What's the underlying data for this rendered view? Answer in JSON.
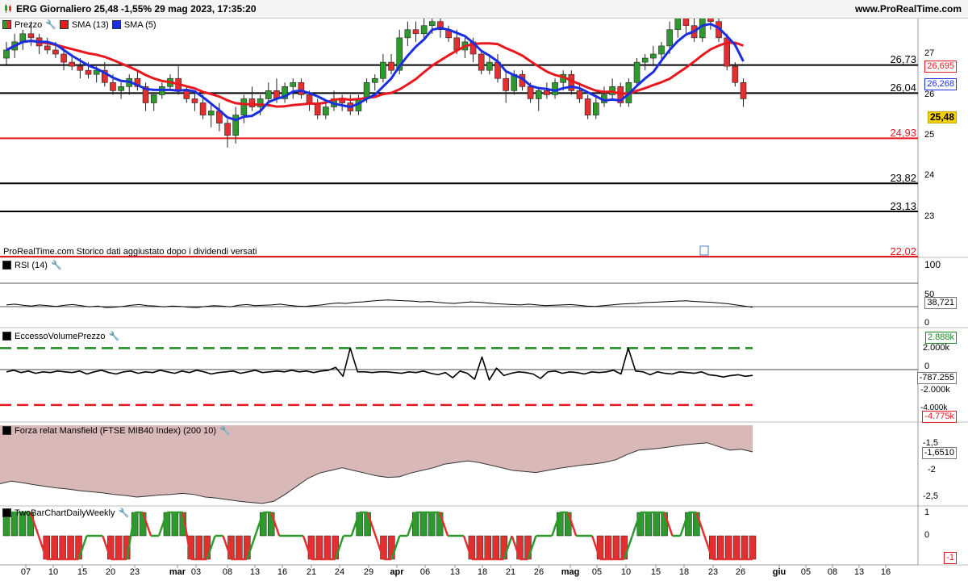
{
  "header": {
    "title": "ERG Giornaliero 25,48 -1,55% 29 mag 2023, 17:35:20",
    "site": "www.ProRealTime.com"
  },
  "price_panel": {
    "legend": [
      "Prezzo",
      "SMA (13)",
      "SMA (5)"
    ],
    "note": "ProRealTime.com  Storico dati aggiustato dopo i dividendi versati",
    "levels": [
      "26,73",
      "26,04",
      "24,93",
      "23,82",
      "23,13",
      "22,02"
    ],
    "axis_ticks": [
      "27",
      "26",
      "25",
      "24",
      "23"
    ],
    "tags": {
      "sma13": "26,695",
      "sma5": "26,268",
      "price": "25,48"
    }
  },
  "rsi_panel": {
    "legend": "RSI (14)",
    "axis_ticks": [
      "100",
      "50",
      "0"
    ],
    "tag": "38,721"
  },
  "evp_panel": {
    "legend": "EccessoVolumePrezzo",
    "axis_ticks": [
      "2.000k",
      "0",
      "-2.000k",
      "-4.000k"
    ],
    "tags": {
      "upper": "2.888k",
      "value": "-787.255",
      "lower": "-4.775k"
    }
  },
  "mansfield_panel": {
    "legend": "Forza relat Mansfield (FTSE MIB40 Index) (200 10)",
    "axis_ticks": [
      "-1,5",
      "-2",
      "-2,5"
    ],
    "tag": "-1,6510"
  },
  "twobar_panel": {
    "legend": "TwoBarChartDailyWeekly",
    "axis_ticks": [
      "1",
      "0"
    ],
    "tag": "-1"
  },
  "x_axis": [
    {
      "label": "07",
      "bold": false
    },
    {
      "label": "10",
      "bold": false
    },
    {
      "label": "15",
      "bold": false
    },
    {
      "label": "20",
      "bold": false
    },
    {
      "label": "23",
      "bold": false
    },
    {
      "label": "mar",
      "bold": true
    },
    {
      "label": "03",
      "bold": false
    },
    {
      "label": "08",
      "bold": false
    },
    {
      "label": "13",
      "bold": false
    },
    {
      "label": "16",
      "bold": false
    },
    {
      "label": "21",
      "bold": false
    },
    {
      "label": "24",
      "bold": false
    },
    {
      "label": "29",
      "bold": false
    },
    {
      "label": "apr",
      "bold": true
    },
    {
      "label": "06",
      "bold": false
    },
    {
      "label": "13",
      "bold": false
    },
    {
      "label": "18",
      "bold": false
    },
    {
      "label": "21",
      "bold": false
    },
    {
      "label": "26",
      "bold": false
    },
    {
      "label": "mag",
      "bold": true
    },
    {
      "label": "05",
      "bold": false
    },
    {
      "label": "10",
      "bold": false
    },
    {
      "label": "15",
      "bold": false
    },
    {
      "label": "18",
      "bold": false
    },
    {
      "label": "23",
      "bold": false
    },
    {
      "label": "26",
      "bold": false
    },
    {
      "label": "giu",
      "bold": true
    },
    {
      "label": "05",
      "bold": false
    },
    {
      "label": "08",
      "bold": false
    },
    {
      "label": "13",
      "bold": false
    },
    {
      "label": "16",
      "bold": false
    }
  ],
  "colors": {
    "up": "#2e9a2e",
    "down": "#e23030",
    "sma13": "#e8181f",
    "sma5": "#1a2fe0",
    "area": "#d9b8b8"
  },
  "chart_data": [
    {
      "type": "candlestick",
      "title": "ERG Giornaliero",
      "ylim": [
        22.0,
        27.5
      ],
      "horizontal_levels": [
        26.73,
        26.04,
        24.93,
        23.82,
        23.13,
        22.02
      ],
      "ohlc": [
        [
          26.9,
          27.3,
          26.7,
          27.1
        ],
        [
          27.1,
          27.5,
          26.9,
          27.3
        ],
        [
          27.3,
          27.6,
          27.1,
          27.5
        ],
        [
          27.5,
          27.8,
          27.2,
          27.4
        ],
        [
          27.4,
          27.5,
          27.0,
          27.2
        ],
        [
          27.2,
          27.4,
          27.0,
          27.1
        ],
        [
          27.1,
          27.3,
          26.9,
          27.0
        ],
        [
          27.0,
          27.2,
          26.6,
          26.8
        ],
        [
          26.8,
          27.0,
          26.6,
          26.7
        ],
        [
          26.7,
          26.9,
          26.4,
          26.6
        ],
        [
          26.6,
          26.8,
          26.4,
          26.5
        ],
        [
          26.5,
          26.7,
          26.3,
          26.6
        ],
        [
          26.6,
          26.8,
          26.2,
          26.3
        ],
        [
          26.3,
          26.5,
          26.0,
          26.1
        ],
        [
          26.1,
          26.3,
          25.9,
          26.2
        ],
        [
          26.2,
          26.5,
          26.0,
          26.4
        ],
        [
          26.4,
          26.6,
          26.1,
          26.2
        ],
        [
          26.2,
          26.3,
          25.6,
          25.8
        ],
        [
          25.8,
          26.0,
          25.6,
          26.0
        ],
        [
          26.0,
          26.3,
          25.9,
          26.2
        ],
        [
          26.2,
          26.5,
          26.1,
          26.4
        ],
        [
          26.4,
          26.7,
          26.0,
          26.1
        ],
        [
          26.1,
          26.2,
          25.8,
          25.9
        ],
        [
          25.9,
          26.1,
          25.6,
          25.8
        ],
        [
          25.8,
          26.0,
          25.4,
          25.5
        ],
        [
          25.5,
          25.8,
          25.2,
          25.6
        ],
        [
          25.6,
          25.8,
          25.1,
          25.3
        ],
        [
          25.3,
          25.4,
          24.7,
          25.0
        ],
        [
          25.0,
          25.7,
          24.8,
          25.5
        ],
        [
          25.5,
          26.0,
          25.3,
          25.9
        ],
        [
          25.9,
          26.2,
          25.6,
          25.7
        ],
        [
          25.7,
          26.0,
          25.5,
          25.9
        ],
        [
          25.9,
          26.3,
          25.7,
          26.1
        ],
        [
          26.1,
          26.4,
          25.8,
          25.9
        ],
        [
          25.9,
          26.3,
          25.8,
          26.2
        ],
        [
          26.2,
          26.4,
          25.9,
          26.3
        ],
        [
          26.3,
          26.4,
          25.9,
          26.0
        ],
        [
          26.0,
          26.1,
          25.6,
          25.8
        ],
        [
          25.8,
          25.9,
          25.4,
          25.5
        ],
        [
          25.5,
          25.8,
          25.4,
          25.7
        ],
        [
          25.7,
          26.1,
          25.6,
          25.9
        ],
        [
          25.9,
          26.0,
          25.6,
          25.8
        ],
        [
          25.8,
          26.0,
          25.5,
          25.6
        ],
        [
          25.6,
          26.0,
          25.5,
          25.9
        ],
        [
          25.9,
          26.4,
          25.8,
          26.3
        ],
        [
          26.3,
          26.5,
          26.1,
          26.4
        ],
        [
          26.4,
          27.0,
          26.3,
          26.8
        ],
        [
          26.8,
          27.0,
          26.5,
          26.6
        ],
        [
          26.6,
          27.6,
          26.5,
          27.4
        ],
        [
          27.4,
          27.8,
          27.2,
          27.6
        ],
        [
          27.6,
          27.8,
          27.3,
          27.5
        ],
        [
          27.5,
          27.9,
          27.4,
          27.7
        ],
        [
          27.7,
          27.9,
          27.5,
          27.8
        ],
        [
          27.8,
          27.9,
          27.4,
          27.6
        ],
        [
          27.6,
          27.7,
          27.3,
          27.4
        ],
        [
          27.4,
          27.6,
          27.0,
          27.1
        ],
        [
          27.1,
          27.4,
          26.9,
          27.3
        ],
        [
          27.3,
          27.4,
          26.8,
          27.0
        ],
        [
          27.0,
          27.1,
          26.5,
          26.6
        ],
        [
          26.6,
          27.0,
          26.5,
          26.8
        ],
        [
          26.8,
          27.0,
          26.3,
          26.4
        ],
        [
          26.4,
          26.6,
          25.8,
          26.1
        ],
        [
          26.1,
          26.6,
          26.0,
          26.5
        ],
        [
          26.5,
          26.6,
          26.1,
          26.2
        ],
        [
          26.2,
          26.3,
          25.8,
          25.9
        ],
        [
          25.9,
          26.2,
          25.6,
          26.1
        ],
        [
          26.1,
          26.3,
          25.9,
          26.0
        ],
        [
          26.0,
          26.4,
          25.9,
          26.3
        ],
        [
          26.3,
          26.6,
          26.1,
          26.5
        ],
        [
          26.5,
          26.6,
          26.0,
          26.1
        ],
        [
          26.1,
          26.3,
          25.8,
          25.9
        ],
        [
          25.9,
          26.0,
          25.4,
          25.5
        ],
        [
          25.5,
          26.0,
          25.4,
          25.8
        ],
        [
          25.8,
          26.2,
          25.7,
          26.0
        ],
        [
          26.0,
          26.4,
          25.9,
          26.2
        ],
        [
          26.2,
          26.3,
          25.7,
          25.8
        ],
        [
          25.8,
          26.4,
          25.7,
          26.3
        ],
        [
          26.3,
          26.9,
          26.2,
          26.8
        ],
        [
          26.8,
          27.0,
          26.6,
          26.9
        ],
        [
          26.9,
          27.2,
          26.7,
          27.0
        ],
        [
          27.0,
          27.3,
          26.8,
          27.2
        ],
        [
          27.2,
          27.8,
          27.0,
          27.6
        ],
        [
          27.6,
          28.1,
          27.4,
          27.9
        ],
        [
          27.9,
          28.0,
          27.5,
          27.7
        ],
        [
          27.7,
          27.9,
          27.3,
          27.4
        ],
        [
          27.4,
          28.2,
          27.3,
          27.9
        ],
        [
          27.9,
          28.0,
          27.6,
          27.8
        ],
        [
          27.8,
          27.9,
          27.3,
          27.4
        ],
        [
          27.4,
          27.5,
          26.6,
          26.7
        ],
        [
          26.7,
          26.8,
          26.2,
          26.3
        ],
        [
          26.3,
          26.4,
          25.7,
          25.9
        ]
      ]
    },
    {
      "type": "line",
      "name": "SMA (13)",
      "last": 26.695
    },
    {
      "type": "line",
      "name": "SMA (5)",
      "last": 26.268
    },
    {
      "type": "line",
      "name": "RSI (14)",
      "ylim": [
        0,
        100
      ],
      "values": [
        45,
        47,
        44,
        42,
        45,
        43,
        41,
        44,
        46,
        43,
        40,
        42,
        38,
        39,
        41,
        44,
        46,
        43,
        42,
        40,
        42,
        41,
        39,
        38,
        41,
        43,
        42,
        40,
        44,
        46,
        43,
        44,
        45,
        47,
        44,
        42,
        41,
        43,
        45,
        48,
        50,
        49,
        52,
        53,
        55,
        57,
        58,
        57,
        56,
        55,
        53,
        54,
        52,
        50,
        49,
        51,
        53,
        52,
        50,
        48,
        47,
        46,
        45,
        47,
        45,
        43,
        44,
        45,
        46,
        44,
        42,
        41,
        43,
        45,
        47,
        48,
        49,
        51,
        52,
        53,
        54,
        55,
        56,
        54,
        53,
        52,
        50,
        48,
        45,
        42,
        38.721
      ]
    },
    {
      "type": "line",
      "name": "EccessoVolumePrezzo",
      "ylim": [
        -5000,
        3200
      ],
      "upper_band": 2888,
      "lower_band": -4775,
      "values": [
        -300,
        -100,
        -400,
        -200,
        -500,
        -300,
        -400,
        -200,
        -300,
        -400,
        -200,
        -600,
        -300,
        -100,
        -400,
        -600,
        -300,
        -200,
        -500,
        -300,
        -400,
        -100,
        -300,
        -500,
        -200,
        -400,
        -100,
        -300,
        -600,
        -400,
        -300,
        -200,
        -500,
        -300,
        -100,
        -400,
        -300,
        -200,
        -300,
        -100,
        -300,
        -200,
        -400,
        -200,
        -100,
        300,
        -900,
        2888,
        -300,
        -300,
        -400,
        -300,
        -300,
        -400,
        -500,
        -300,
        -400,
        -200,
        -500,
        -700,
        -400,
        -1100,
        -200,
        -500,
        -1300,
        1700,
        -1400,
        200,
        -800,
        -500,
        -300,
        -400,
        -600,
        -1200,
        -300,
        -200,
        -500,
        -300,
        -400,
        -600,
        -300,
        -400,
        -300,
        -100,
        -600,
        2888,
        -200,
        -300,
        -700,
        -300,
        -500,
        -600,
        -300,
        -400,
        -500,
        -300,
        -700,
        -800,
        -1000,
        -800,
        -700,
        -900,
        -787.255
      ]
    },
    {
      "type": "area",
      "name": "Forza relat Mansfield (FTSE MIB40 Index)",
      "ylim": [
        -2.75,
        -1.35
      ],
      "values": [
        -2.25,
        -2.2,
        -2.23,
        -2.27,
        -2.3,
        -2.33,
        -2.35,
        -2.38,
        -2.4,
        -2.42,
        -2.45,
        -2.47,
        -2.5,
        -2.48,
        -2.46,
        -2.45,
        -2.43,
        -2.45,
        -2.5,
        -2.52,
        -2.55,
        -2.58,
        -2.6,
        -2.62,
        -2.58,
        -2.45,
        -2.3,
        -2.15,
        -2.05,
        -2.0,
        -1.95,
        -2.0,
        -2.05,
        -2.1,
        -2.13,
        -2.12,
        -2.05,
        -2.0,
        -1.95,
        -1.88,
        -1.85,
        -1.82,
        -1.85,
        -1.9,
        -1.95,
        -2.0,
        -2.02,
        -2.04,
        -2.0,
        -1.96,
        -1.93,
        -1.9,
        -1.88,
        -1.85,
        -1.8,
        -1.7,
        -1.62,
        -1.6,
        -1.58,
        -1.55,
        -1.52,
        -1.5,
        -1.48,
        -1.55,
        -1.62,
        -1.6,
        -1.651
      ]
    },
    {
      "type": "bar",
      "name": "TwoBarChartDailyWeekly",
      "ylim": [
        -1.15,
        1.15
      ],
      "values": [
        1,
        1,
        1,
        1,
        0,
        -1,
        -1,
        -1,
        -1,
        -1,
        0,
        0,
        0,
        -1,
        -1,
        -1,
        1,
        1,
        0,
        0,
        1,
        1,
        1,
        -1,
        -1,
        -1,
        0,
        0,
        -1,
        -1,
        -1,
        0,
        1,
        1,
        0,
        0,
        0,
        0,
        -1,
        -1,
        -1,
        -1,
        0,
        0,
        1,
        1,
        0,
        -1,
        -1,
        0,
        0,
        1,
        1,
        1,
        1,
        0,
        0,
        0,
        -1,
        -1,
        -1,
        -1,
        -1,
        0,
        -1,
        -1,
        0,
        0,
        0,
        1,
        1,
        0,
        0,
        0,
        -1,
        -1,
        -1,
        -1,
        0,
        1,
        1,
        1,
        1,
        0,
        0,
        1,
        1,
        0,
        -1,
        -1,
        -1,
        -1,
        -1,
        -1
      ]
    }
  ]
}
